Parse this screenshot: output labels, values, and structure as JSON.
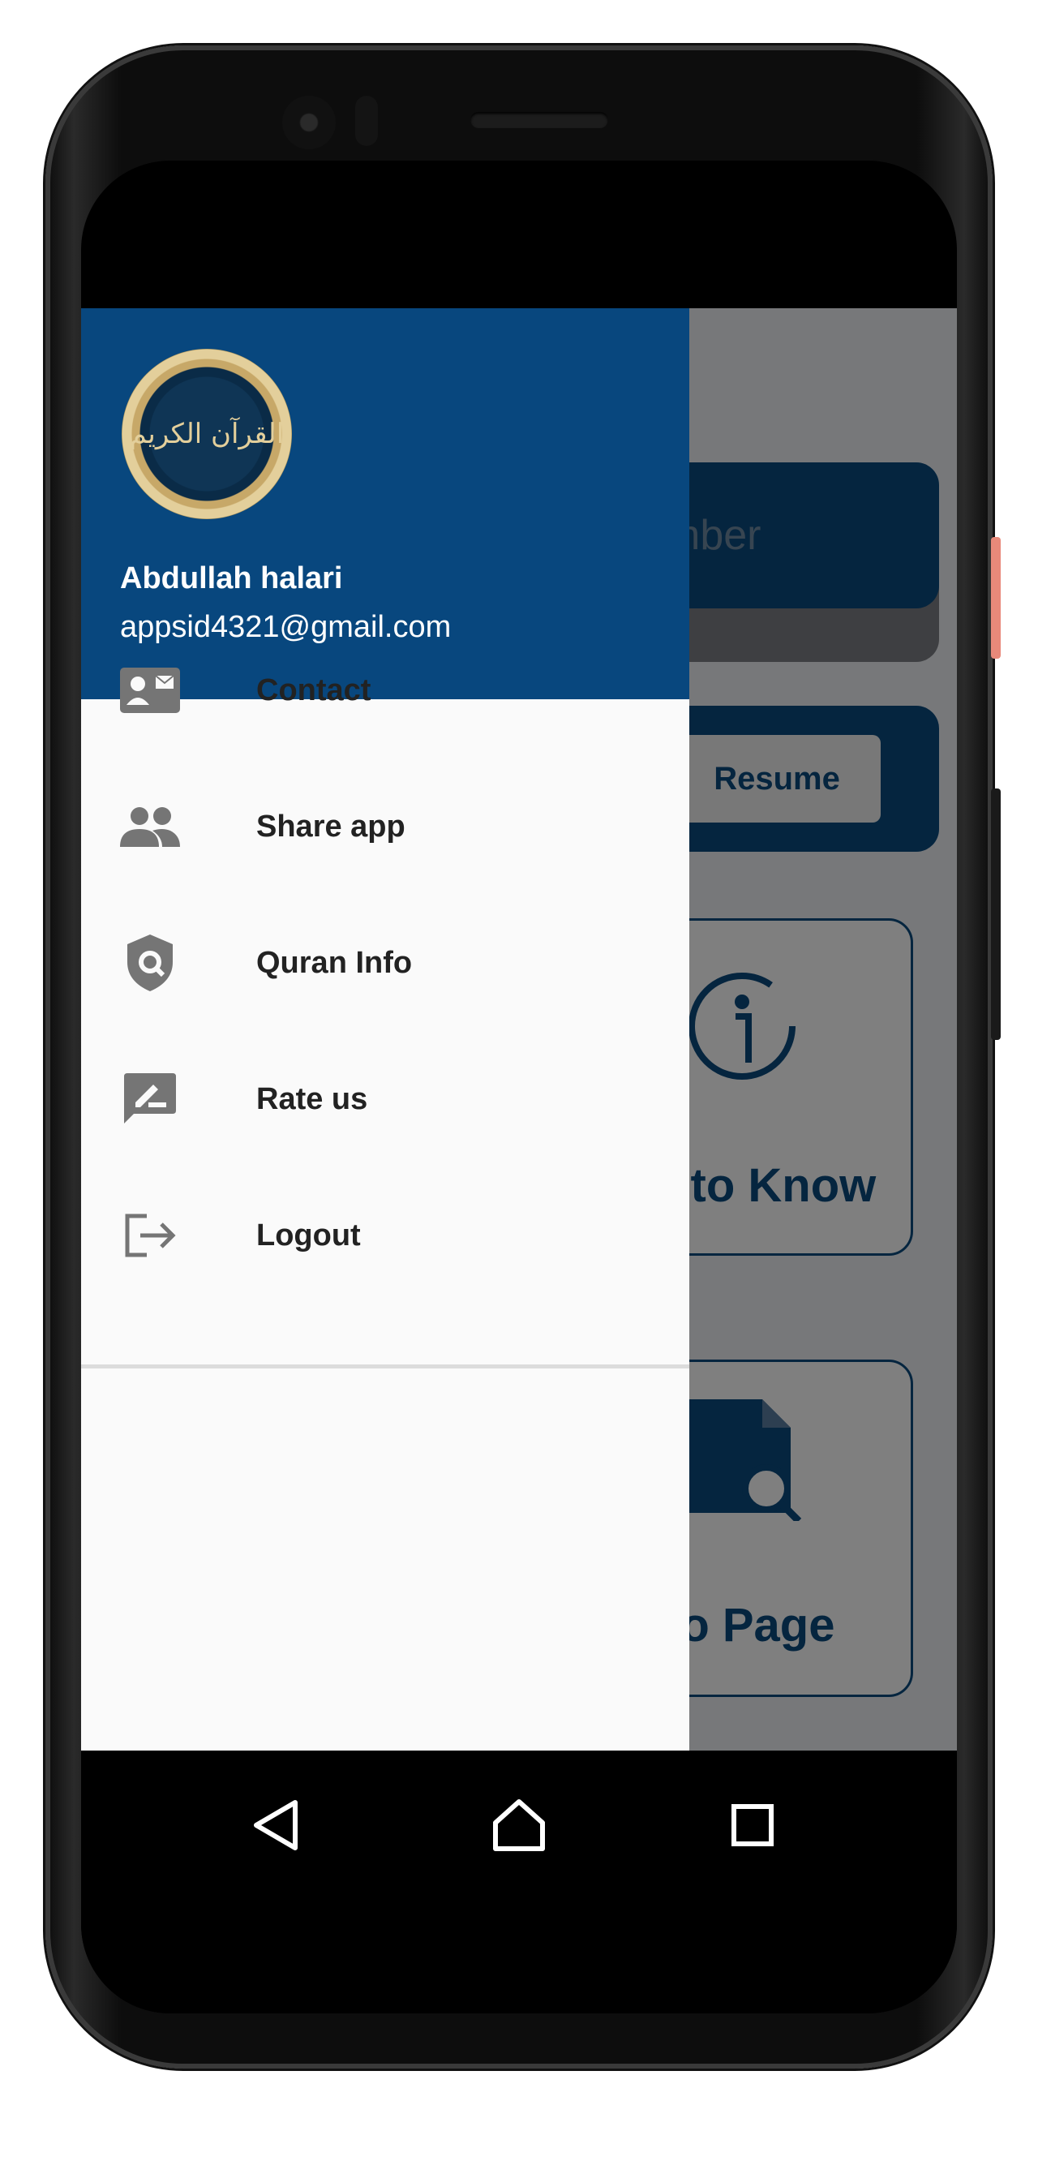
{
  "drawer": {
    "header": {
      "logo_text": "القرآن الكريم",
      "user_name": "Abdullah halari",
      "user_email": "appsid4321@gmail.com"
    },
    "items": [
      {
        "label": "Contact",
        "icon": "contact-card-icon"
      },
      {
        "label": "Share app",
        "icon": "people-icon"
      },
      {
        "label": "Quran Info",
        "icon": "shield-search-icon"
      },
      {
        "label": "Rate us",
        "icon": "rate-edit-icon"
      },
      {
        "label": "Logout",
        "icon": "logout-icon"
      }
    ]
  },
  "background": {
    "search_placeholder_partial": "mber",
    "resume_label": "Resume",
    "feature_1_label_partial": "d to Know",
    "feature_2_label_partial": "to Page"
  },
  "navbar": {
    "icons": [
      "back-icon",
      "home-icon",
      "recents-icon"
    ]
  },
  "colors": {
    "primary": "#08477e",
    "drawer_bg": "#fafafa",
    "icon_gray": "#757575"
  }
}
